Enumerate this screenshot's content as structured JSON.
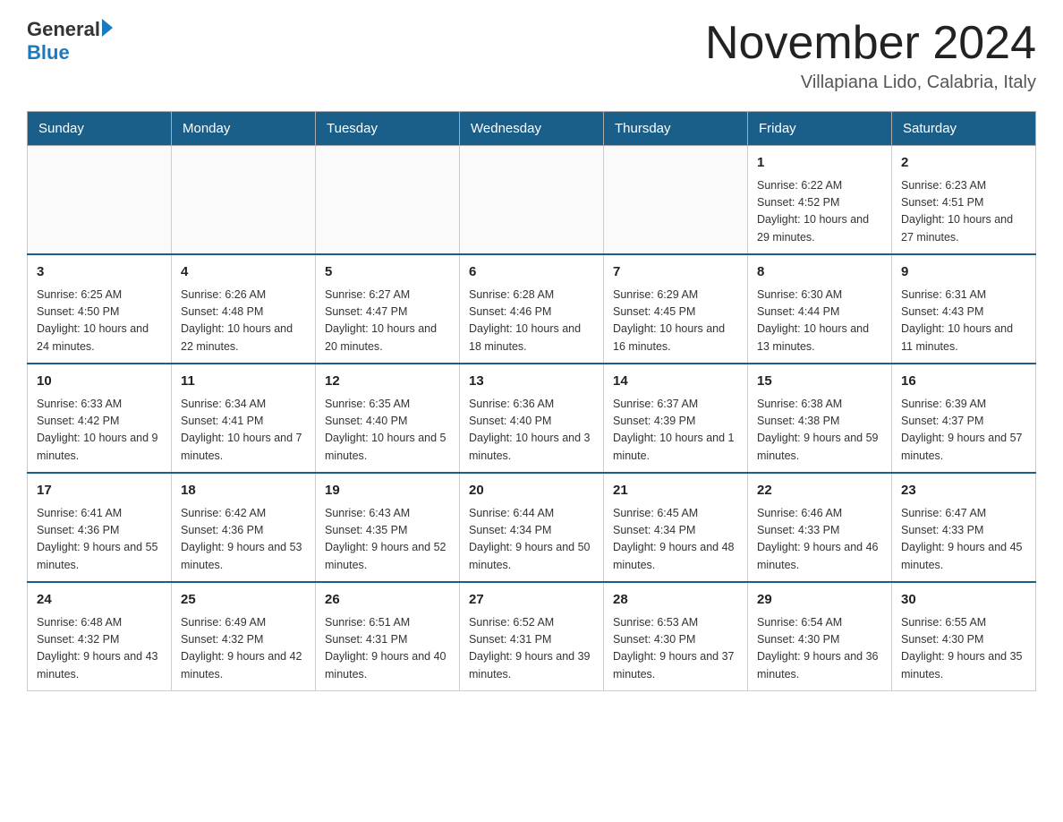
{
  "header": {
    "logo_general": "General",
    "logo_blue": "Blue",
    "month_title": "November 2024",
    "location": "Villapiana Lido, Calabria, Italy"
  },
  "days_of_week": [
    "Sunday",
    "Monday",
    "Tuesday",
    "Wednesday",
    "Thursday",
    "Friday",
    "Saturday"
  ],
  "weeks": [
    [
      {
        "day": "",
        "info": ""
      },
      {
        "day": "",
        "info": ""
      },
      {
        "day": "",
        "info": ""
      },
      {
        "day": "",
        "info": ""
      },
      {
        "day": "",
        "info": ""
      },
      {
        "day": "1",
        "info": "Sunrise: 6:22 AM\nSunset: 4:52 PM\nDaylight: 10 hours and 29 minutes."
      },
      {
        "day": "2",
        "info": "Sunrise: 6:23 AM\nSunset: 4:51 PM\nDaylight: 10 hours and 27 minutes."
      }
    ],
    [
      {
        "day": "3",
        "info": "Sunrise: 6:25 AM\nSunset: 4:50 PM\nDaylight: 10 hours and 24 minutes."
      },
      {
        "day": "4",
        "info": "Sunrise: 6:26 AM\nSunset: 4:48 PM\nDaylight: 10 hours and 22 minutes."
      },
      {
        "day": "5",
        "info": "Sunrise: 6:27 AM\nSunset: 4:47 PM\nDaylight: 10 hours and 20 minutes."
      },
      {
        "day": "6",
        "info": "Sunrise: 6:28 AM\nSunset: 4:46 PM\nDaylight: 10 hours and 18 minutes."
      },
      {
        "day": "7",
        "info": "Sunrise: 6:29 AM\nSunset: 4:45 PM\nDaylight: 10 hours and 16 minutes."
      },
      {
        "day": "8",
        "info": "Sunrise: 6:30 AM\nSunset: 4:44 PM\nDaylight: 10 hours and 13 minutes."
      },
      {
        "day": "9",
        "info": "Sunrise: 6:31 AM\nSunset: 4:43 PM\nDaylight: 10 hours and 11 minutes."
      }
    ],
    [
      {
        "day": "10",
        "info": "Sunrise: 6:33 AM\nSunset: 4:42 PM\nDaylight: 10 hours and 9 minutes."
      },
      {
        "day": "11",
        "info": "Sunrise: 6:34 AM\nSunset: 4:41 PM\nDaylight: 10 hours and 7 minutes."
      },
      {
        "day": "12",
        "info": "Sunrise: 6:35 AM\nSunset: 4:40 PM\nDaylight: 10 hours and 5 minutes."
      },
      {
        "day": "13",
        "info": "Sunrise: 6:36 AM\nSunset: 4:40 PM\nDaylight: 10 hours and 3 minutes."
      },
      {
        "day": "14",
        "info": "Sunrise: 6:37 AM\nSunset: 4:39 PM\nDaylight: 10 hours and 1 minute."
      },
      {
        "day": "15",
        "info": "Sunrise: 6:38 AM\nSunset: 4:38 PM\nDaylight: 9 hours and 59 minutes."
      },
      {
        "day": "16",
        "info": "Sunrise: 6:39 AM\nSunset: 4:37 PM\nDaylight: 9 hours and 57 minutes."
      }
    ],
    [
      {
        "day": "17",
        "info": "Sunrise: 6:41 AM\nSunset: 4:36 PM\nDaylight: 9 hours and 55 minutes."
      },
      {
        "day": "18",
        "info": "Sunrise: 6:42 AM\nSunset: 4:36 PM\nDaylight: 9 hours and 53 minutes."
      },
      {
        "day": "19",
        "info": "Sunrise: 6:43 AM\nSunset: 4:35 PM\nDaylight: 9 hours and 52 minutes."
      },
      {
        "day": "20",
        "info": "Sunrise: 6:44 AM\nSunset: 4:34 PM\nDaylight: 9 hours and 50 minutes."
      },
      {
        "day": "21",
        "info": "Sunrise: 6:45 AM\nSunset: 4:34 PM\nDaylight: 9 hours and 48 minutes."
      },
      {
        "day": "22",
        "info": "Sunrise: 6:46 AM\nSunset: 4:33 PM\nDaylight: 9 hours and 46 minutes."
      },
      {
        "day": "23",
        "info": "Sunrise: 6:47 AM\nSunset: 4:33 PM\nDaylight: 9 hours and 45 minutes."
      }
    ],
    [
      {
        "day": "24",
        "info": "Sunrise: 6:48 AM\nSunset: 4:32 PM\nDaylight: 9 hours and 43 minutes."
      },
      {
        "day": "25",
        "info": "Sunrise: 6:49 AM\nSunset: 4:32 PM\nDaylight: 9 hours and 42 minutes."
      },
      {
        "day": "26",
        "info": "Sunrise: 6:51 AM\nSunset: 4:31 PM\nDaylight: 9 hours and 40 minutes."
      },
      {
        "day": "27",
        "info": "Sunrise: 6:52 AM\nSunset: 4:31 PM\nDaylight: 9 hours and 39 minutes."
      },
      {
        "day": "28",
        "info": "Sunrise: 6:53 AM\nSunset: 4:30 PM\nDaylight: 9 hours and 37 minutes."
      },
      {
        "day": "29",
        "info": "Sunrise: 6:54 AM\nSunset: 4:30 PM\nDaylight: 9 hours and 36 minutes."
      },
      {
        "day": "30",
        "info": "Sunrise: 6:55 AM\nSunset: 4:30 PM\nDaylight: 9 hours and 35 minutes."
      }
    ]
  ]
}
